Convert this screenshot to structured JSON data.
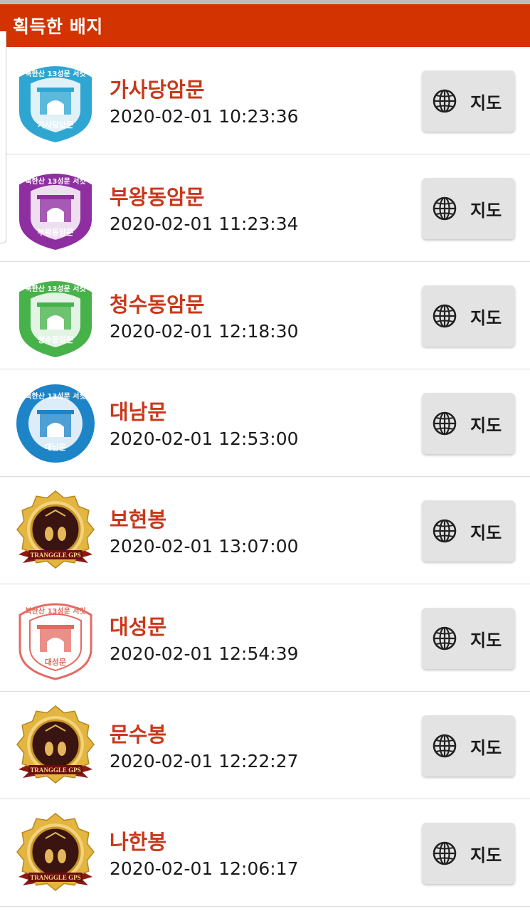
{
  "header": {
    "title": "획득한 배지"
  },
  "badges": [
    {
      "name": "가사당암문",
      "time": "2020-02-01 10:23:36",
      "map_label": "지도",
      "stamp_type": "stamp-shield",
      "color": "#2fa6d1",
      "stamp_top": "북한산 13성문 서킷",
      "stamp_bottom": "가사당암문"
    },
    {
      "name": "부왕동암문",
      "time": "2020-02-01 11:23:34",
      "map_label": "지도",
      "stamp_type": "stamp-shield",
      "color": "#8e2ea0",
      "stamp_top": "북한산 13성문 서킷",
      "stamp_bottom": "부왕동암문"
    },
    {
      "name": "청수동암문",
      "time": "2020-02-01 12:18:30",
      "map_label": "지도",
      "stamp_type": "stamp-shield",
      "color": "#47b24a",
      "stamp_top": "북한산 13성문 서킷",
      "stamp_bottom": "청수동암문"
    },
    {
      "name": "대남문",
      "time": "2020-02-01 12:53:00",
      "map_label": "지도",
      "stamp_type": "stamp-round",
      "color": "#1e84c8",
      "stamp_top": "북한산 13성문 서킷",
      "stamp_bottom": "대남문"
    },
    {
      "name": "보현봉",
      "time": "2020-02-01 13:07:00",
      "map_label": "지도",
      "stamp_type": "gold-medal",
      "color": "#d4a531",
      "medal_text": "TRANGGLE GPS"
    },
    {
      "name": "대성문",
      "time": "2020-02-01 12:54:39",
      "map_label": "지도",
      "stamp_type": "stamp-shield-outline",
      "color": "#e26b61",
      "stamp_top": "북한산 13성문 서킷",
      "stamp_bottom": "대성문"
    },
    {
      "name": "문수봉",
      "time": "2020-02-01 12:22:27",
      "map_label": "지도",
      "stamp_type": "gold-medal",
      "color": "#d4a531",
      "medal_text": "TRANGGLE GPS"
    },
    {
      "name": "나한봉",
      "time": "2020-02-01 12:06:17",
      "map_label": "지도",
      "stamp_type": "gold-medal",
      "color": "#d4a531",
      "medal_text": "TRANGGLE GPS"
    }
  ]
}
